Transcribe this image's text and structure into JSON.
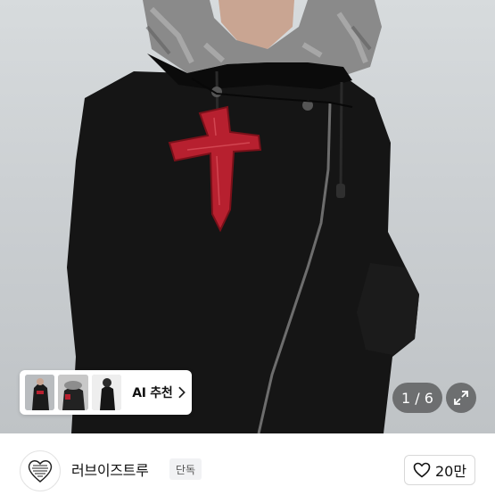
{
  "gallery": {
    "page_current": "1",
    "page_total": "6",
    "page_text": "1 / 6"
  },
  "ai_recommend": {
    "label": "AI 추천"
  },
  "shop": {
    "name": "러브이즈트루",
    "badge": "단독",
    "likes": "20만"
  },
  "icons": {
    "expand": "expand-icon",
    "heart": "heart-icon",
    "chevron": "chevron-right-icon"
  },
  "colors": {
    "cross_red": "#b7202f",
    "jacket": "#151515"
  }
}
